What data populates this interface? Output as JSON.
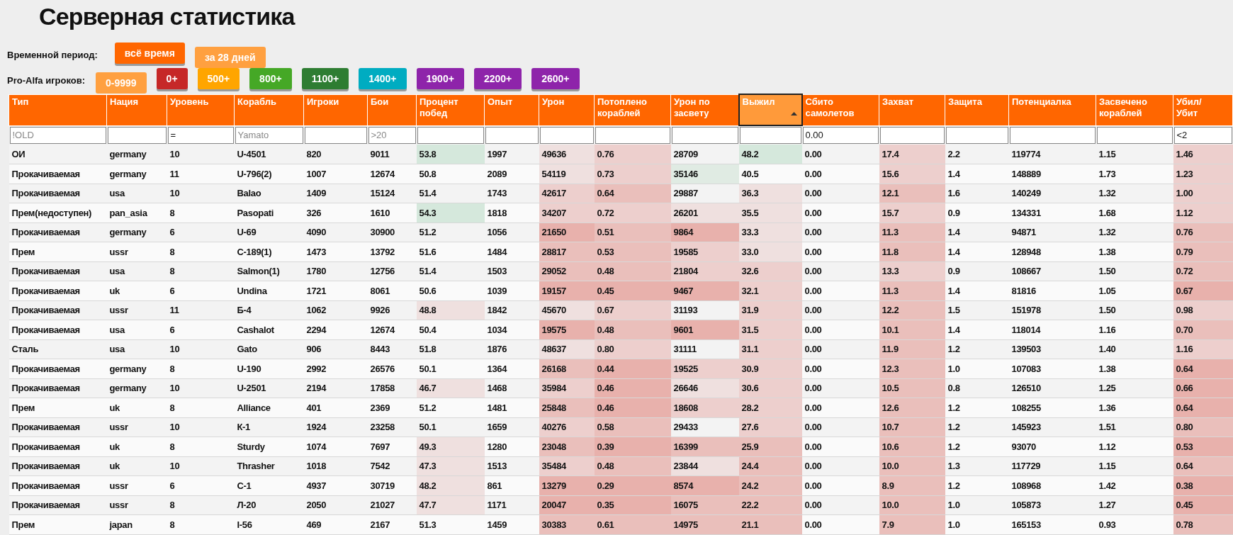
{
  "title": "Серверная статистика",
  "period": {
    "label": "Временной период:",
    "buttons": [
      {
        "label": "всё время",
        "selected": false
      },
      {
        "label": "за 28 дней",
        "selected": true
      }
    ]
  },
  "players": {
    "label": "Pro-Alfa игроков:",
    "buttons": [
      {
        "label": "0-9999",
        "selected": true,
        "color": "#ffa040"
      },
      {
        "label": "0+",
        "selected": false,
        "color": "#c62828"
      },
      {
        "label": "500+",
        "selected": false,
        "color": "#ffa500"
      },
      {
        "label": "800+",
        "selected": false,
        "color": "#45a826"
      },
      {
        "label": "1100+",
        "selected": false,
        "color": "#2e7d32"
      },
      {
        "label": "1400+",
        "selected": false,
        "color": "#00acc1"
      },
      {
        "label": "1900+",
        "selected": false,
        "color": "#8e24aa"
      },
      {
        "label": "2200+",
        "selected": false,
        "color": "#8e24aa"
      },
      {
        "label": "2600+",
        "selected": false,
        "color": "#8e24aa"
      }
    ]
  },
  "table": {
    "columns": [
      {
        "label": "Тип",
        "sorted": false,
        "filter_placeholder": "!OLD"
      },
      {
        "label": "Нация",
        "sorted": false
      },
      {
        "label": "Уровень",
        "sorted": false,
        "filter_value": "="
      },
      {
        "label": "Корабль",
        "sorted": false,
        "filter_placeholder": "Yamato"
      },
      {
        "label": "Игроки",
        "sorted": false
      },
      {
        "label": "Бои",
        "sorted": false,
        "filter_placeholder": ">20"
      },
      {
        "label": "Процент побед",
        "sorted": false
      },
      {
        "label": "Опыт",
        "sorted": false
      },
      {
        "label": "Урон",
        "sorted": false
      },
      {
        "label": "Потоплено кораблей",
        "sorted": false
      },
      {
        "label": "Урон по засвету",
        "sorted": false
      },
      {
        "label": "Выжил",
        "sorted": true
      },
      {
        "label": "Сбито самолетов",
        "sorted": false,
        "filter_value": "0.00"
      },
      {
        "label": "Захват",
        "sorted": false
      },
      {
        "label": "Защита",
        "sorted": false
      },
      {
        "label": "Потенциалка",
        "sorted": false
      },
      {
        "label": "Засвечено кораблей",
        "sorted": false
      },
      {
        "label": "Убил/ Убит",
        "sorted": false,
        "filter_value": "<2"
      }
    ],
    "rows": [
      [
        "ОИ",
        "germany",
        "10",
        "U-4501",
        "820",
        "9011",
        {
          "text": "53.8",
          "color": "#d5e8dc"
        },
        "1997",
        {
          "text": "49636",
          "color": "#efe0df"
        },
        {
          "text": "0.76",
          "color": "#edcfcd"
        },
        "28709",
        {
          "text": "48.2",
          "color": "#d5e8dc"
        },
        "0.00",
        {
          "text": "17.4",
          "color": "#edcfcd"
        },
        "2.2",
        "119774",
        "1.15",
        {
          "text": "1.46",
          "color": "#edcfcd"
        }
      ],
      [
        "Прокачиваемая",
        "germany",
        "11",
        "U-796(2)",
        "1007",
        "12674",
        "50.8",
        "2089",
        {
          "text": "54119",
          "color": "#efe0df"
        },
        {
          "text": "0.73",
          "color": "#edcfcd"
        },
        {
          "text": "35146",
          "color": "#e0ebe3"
        },
        "40.5",
        "0.00",
        {
          "text": "15.6",
          "color": "#edcfcd"
        },
        "1.4",
        "148889",
        "1.73",
        {
          "text": "1.23",
          "color": "#edcfcd"
        }
      ],
      [
        "Прокачиваемая",
        "usa",
        "10",
        "Balao",
        "1409",
        "15124",
        "51.4",
        "1743",
        {
          "text": "42617",
          "color": "#edcfcd"
        },
        {
          "text": "0.64",
          "color": "#eabfbb"
        },
        "29887",
        {
          "text": "36.3",
          "color": "#efe0df"
        },
        "0.00",
        {
          "text": "12.1",
          "color": "#eabfbb"
        },
        "1.6",
        "140249",
        "1.32",
        {
          "text": "1.00",
          "color": "#edcfcd"
        }
      ],
      [
        "Прем(недоступен)",
        "pan_asia",
        "8",
        "Pasopati",
        "326",
        "1610",
        {
          "text": "54.3",
          "color": "#d5e8dc"
        },
        "1818",
        {
          "text": "34207",
          "color": "#edcfcd"
        },
        {
          "text": "0.72",
          "color": "#edcfcd"
        },
        {
          "text": "26201",
          "color": "#efe0df"
        },
        {
          "text": "35.5",
          "color": "#efe0df"
        },
        "0.00",
        {
          "text": "15.7",
          "color": "#edcfcd"
        },
        "0.9",
        "134331",
        "1.68",
        {
          "text": "1.12",
          "color": "#edcfcd"
        }
      ],
      [
        "Прокачиваемая",
        "germany",
        "6",
        "U-69",
        "4090",
        "30900",
        "51.2",
        "1056",
        {
          "text": "21650",
          "color": "#e8b1ac"
        },
        {
          "text": "0.51",
          "color": "#eabfbb"
        },
        {
          "text": "9864",
          "color": "#e8b1ac"
        },
        {
          "text": "33.3",
          "color": "#efe0df"
        },
        "0.00",
        {
          "text": "11.3",
          "color": "#eabfbb"
        },
        "1.4",
        "94871",
        "1.32",
        {
          "text": "0.76",
          "color": "#eabfbb"
        }
      ],
      [
        "Прем",
        "ussr",
        "8",
        "С-189(1)",
        "1473",
        "13792",
        "51.6",
        "1484",
        {
          "text": "28817",
          "color": "#eabfbb"
        },
        {
          "text": "0.53",
          "color": "#eabfbb"
        },
        {
          "text": "19585",
          "color": "#edcfcd"
        },
        {
          "text": "33.0",
          "color": "#efe0df"
        },
        "0.00",
        {
          "text": "11.8",
          "color": "#eabfbb"
        },
        "1.4",
        "128948",
        "1.38",
        {
          "text": "0.79",
          "color": "#eabfbb"
        }
      ],
      [
        "Прокачиваемая",
        "usa",
        "8",
        "Salmon(1)",
        "1780",
        "12756",
        "51.4",
        "1503",
        {
          "text": "29052",
          "color": "#eabfbb"
        },
        {
          "text": "0.48",
          "color": "#eabfbb"
        },
        {
          "text": "21804",
          "color": "#edcfcd"
        },
        {
          "text": "32.6",
          "color": "#edcfcd"
        },
        "0.00",
        {
          "text": "13.3",
          "color": "#edcfcd"
        },
        "0.9",
        "108667",
        "1.50",
        {
          "text": "0.72",
          "color": "#eabfbb"
        }
      ],
      [
        "Прокачиваемая",
        "uk",
        "6",
        "Undina",
        "1721",
        "8061",
        "50.6",
        "1039",
        {
          "text": "19157",
          "color": "#e8b1ac"
        },
        {
          "text": "0.45",
          "color": "#e8b1ac"
        },
        {
          "text": "9467",
          "color": "#e8b1ac"
        },
        {
          "text": "32.1",
          "color": "#edcfcd"
        },
        "0.00",
        {
          "text": "11.3",
          "color": "#eabfbb"
        },
        "1.4",
        "81816",
        "1.05",
        {
          "text": "0.67",
          "color": "#e8b1ac"
        }
      ],
      [
        "Прокачиваемая",
        "ussr",
        "11",
        "Б-4",
        "1062",
        "9926",
        {
          "text": "48.8",
          "color": "#efe0df"
        },
        "1842",
        {
          "text": "45670",
          "color": "#efe0df"
        },
        {
          "text": "0.67",
          "color": "#edcfcd"
        },
        "31193",
        {
          "text": "31.9",
          "color": "#edcfcd"
        },
        "0.00",
        {
          "text": "12.2",
          "color": "#eabfbb"
        },
        "1.5",
        "151978",
        "1.50",
        {
          "text": "0.98",
          "color": "#edcfcd"
        }
      ],
      [
        "Прокачиваемая",
        "usa",
        "6",
        "Cashalot",
        "2294",
        "12674",
        "50.4",
        "1034",
        {
          "text": "19575",
          "color": "#e8b1ac"
        },
        {
          "text": "0.48",
          "color": "#eabfbb"
        },
        {
          "text": "9601",
          "color": "#e8b1ac"
        },
        {
          "text": "31.5",
          "color": "#edcfcd"
        },
        "0.00",
        {
          "text": "10.1",
          "color": "#eabfbb"
        },
        "1.4",
        "118014",
        "1.16",
        {
          "text": "0.70",
          "color": "#eabfbb"
        }
      ],
      [
        "Сталь",
        "usa",
        "10",
        "Gato",
        "906",
        "8443",
        "51.8",
        "1876",
        {
          "text": "48637",
          "color": "#efe0df"
        },
        {
          "text": "0.80",
          "color": "#edcfcd"
        },
        "31111",
        {
          "text": "31.1",
          "color": "#edcfcd"
        },
        "0.00",
        {
          "text": "11.9",
          "color": "#eabfbb"
        },
        "1.2",
        "139503",
        "1.40",
        {
          "text": "1.16",
          "color": "#edcfcd"
        }
      ],
      [
        "Прокачиваемая",
        "germany",
        "8",
        "U-190",
        "2992",
        "26576",
        "50.1",
        "1364",
        {
          "text": "26168",
          "color": "#eabfbb"
        },
        {
          "text": "0.44",
          "color": "#e8b1ac"
        },
        {
          "text": "19525",
          "color": "#edcfcd"
        },
        {
          "text": "30.9",
          "color": "#edcfcd"
        },
        "0.00",
        {
          "text": "12.3",
          "color": "#eabfbb"
        },
        "1.0",
        "107083",
        "1.38",
        {
          "text": "0.64",
          "color": "#e8b1ac"
        }
      ],
      [
        "Прокачиваемая",
        "germany",
        "10",
        "U-2501",
        "2194",
        "17858",
        {
          "text": "46.7",
          "color": "#efe0df"
        },
        "1468",
        {
          "text": "35984",
          "color": "#edcfcd"
        },
        {
          "text": "0.46",
          "color": "#e8b1ac"
        },
        {
          "text": "26646",
          "color": "#efe0df"
        },
        {
          "text": "30.6",
          "color": "#edcfcd"
        },
        "0.00",
        {
          "text": "10.5",
          "color": "#eabfbb"
        },
        "0.8",
        "126510",
        "1.25",
        {
          "text": "0.66",
          "color": "#e8b1ac"
        }
      ],
      [
        "Прем",
        "uk",
        "8",
        "Alliance",
        "401",
        "2369",
        "51.2",
        "1481",
        {
          "text": "25848",
          "color": "#eabfbb"
        },
        {
          "text": "0.46",
          "color": "#e8b1ac"
        },
        {
          "text": "18608",
          "color": "#edcfcd"
        },
        {
          "text": "28.2",
          "color": "#edcfcd"
        },
        "0.00",
        {
          "text": "12.6",
          "color": "#eabfbb"
        },
        "1.2",
        "108255",
        "1.36",
        {
          "text": "0.64",
          "color": "#e8b1ac"
        }
      ],
      [
        "Прокачиваемая",
        "ussr",
        "10",
        "К-1",
        "1924",
        "23258",
        "50.1",
        "1659",
        {
          "text": "40276",
          "color": "#edcfcd"
        },
        {
          "text": "0.58",
          "color": "#eabfbb"
        },
        "29433",
        {
          "text": "27.6",
          "color": "#edcfcd"
        },
        "0.00",
        {
          "text": "10.7",
          "color": "#eabfbb"
        },
        "1.2",
        "145923",
        "1.51",
        {
          "text": "0.80",
          "color": "#eabfbb"
        }
      ],
      [
        "Прокачиваемая",
        "uk",
        "8",
        "Sturdy",
        "1074",
        "7697",
        {
          "text": "49.3",
          "color": "#efe0df"
        },
        "1280",
        {
          "text": "23048",
          "color": "#eabfbb"
        },
        {
          "text": "0.39",
          "color": "#e8b1ac"
        },
        {
          "text": "16399",
          "color": "#eabfbb"
        },
        {
          "text": "25.9",
          "color": "#eabfbb"
        },
        "0.00",
        {
          "text": "10.6",
          "color": "#eabfbb"
        },
        "1.2",
        "93070",
        "1.12",
        {
          "text": "0.53",
          "color": "#e8b1ac"
        }
      ],
      [
        "Прокачиваемая",
        "uk",
        "10",
        "Thrasher",
        "1018",
        "7542",
        {
          "text": "47.3",
          "color": "#efe0df"
        },
        "1513",
        {
          "text": "35484",
          "color": "#edcfcd"
        },
        {
          "text": "0.48",
          "color": "#eabfbb"
        },
        {
          "text": "23844",
          "color": "#efe0df"
        },
        {
          "text": "24.4",
          "color": "#eabfbb"
        },
        "0.00",
        {
          "text": "10.0",
          "color": "#eabfbb"
        },
        "1.3",
        "117729",
        "1.15",
        {
          "text": "0.64",
          "color": "#eabfbb"
        }
      ],
      [
        "Прокачиваемая",
        "ussr",
        "6",
        "С-1",
        "4937",
        "30719",
        {
          "text": "48.2",
          "color": "#efe0df"
        },
        "861",
        {
          "text": "13279",
          "color": "#e8b1ac"
        },
        {
          "text": "0.29",
          "color": "#e8b1ac"
        },
        {
          "text": "8574",
          "color": "#e8b1ac"
        },
        {
          "text": "24.2",
          "color": "#eabfbb"
        },
        "0.00",
        {
          "text": "8.9",
          "color": "#eabfbb"
        },
        "1.2",
        "108968",
        "1.42",
        {
          "text": "0.38",
          "color": "#e8b1ac"
        }
      ],
      [
        "Прокачиваемая",
        "ussr",
        "8",
        "Л-20",
        "2050",
        "21027",
        {
          "text": "47.7",
          "color": "#efe0df"
        },
        "1171",
        {
          "text": "20047",
          "color": "#e8b1ac"
        },
        {
          "text": "0.35",
          "color": "#e8b1ac"
        },
        {
          "text": "16075",
          "color": "#eabfbb"
        },
        {
          "text": "22.2",
          "color": "#eabfbb"
        },
        "0.00",
        {
          "text": "10.0",
          "color": "#eabfbb"
        },
        "1.0",
        "105873",
        "1.27",
        {
          "text": "0.45",
          "color": "#e8b1ac"
        }
      ],
      [
        "Прем",
        "japan",
        "8",
        "I-56",
        "469",
        "2167",
        "51.3",
        "1459",
        {
          "text": "30383",
          "color": "#eabfbb"
        },
        {
          "text": "0.61",
          "color": "#eabfbb"
        },
        {
          "text": "14975",
          "color": "#eabfbb"
        },
        {
          "text": "21.1",
          "color": "#eabfbb"
        },
        "0.00",
        {
          "text": "7.9",
          "color": "#eabfbb"
        },
        "1.0",
        "165153",
        "0.93",
        {
          "text": "0.78",
          "color": "#eabfbb"
        }
      ]
    ]
  }
}
